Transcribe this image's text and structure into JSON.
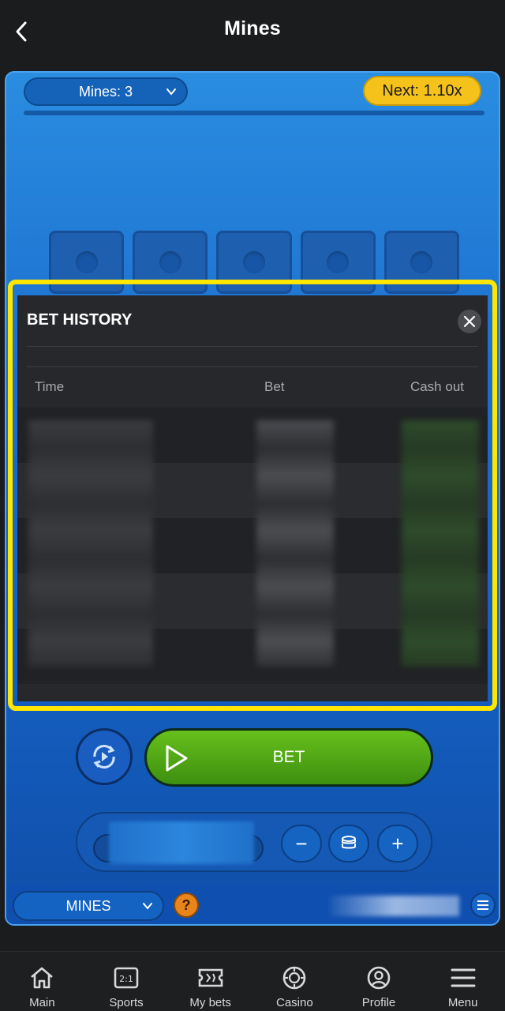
{
  "header": {
    "title": "Mines",
    "back_icon": "chevron-left-icon"
  },
  "game": {
    "mines_select": "Mines: 3",
    "next_multiplier": "Next: 1.10x",
    "bet_button": "BET",
    "minus": "−",
    "plus": "+",
    "game_select": "MINES",
    "help": "?"
  },
  "bet_history": {
    "title": "BET HISTORY",
    "columns": [
      "Time",
      "Bet",
      "Cash out"
    ],
    "row_count": 5
  },
  "nav": {
    "items": [
      {
        "label": "Main",
        "icon": "home-icon"
      },
      {
        "label": "Sports",
        "icon": "scoreboard-icon"
      },
      {
        "label": "My bets",
        "icon": "ticket-icon"
      },
      {
        "label": "Casino",
        "icon": "casino-chip-icon"
      },
      {
        "label": "Profile",
        "icon": "profile-icon"
      },
      {
        "label": "Menu",
        "icon": "menu-icon"
      }
    ]
  },
  "colors": {
    "accent_yellow": "#f5c21b",
    "bet_green": "#4fa514",
    "game_blue": "#1c6fcf",
    "highlight": "#ffe600"
  }
}
